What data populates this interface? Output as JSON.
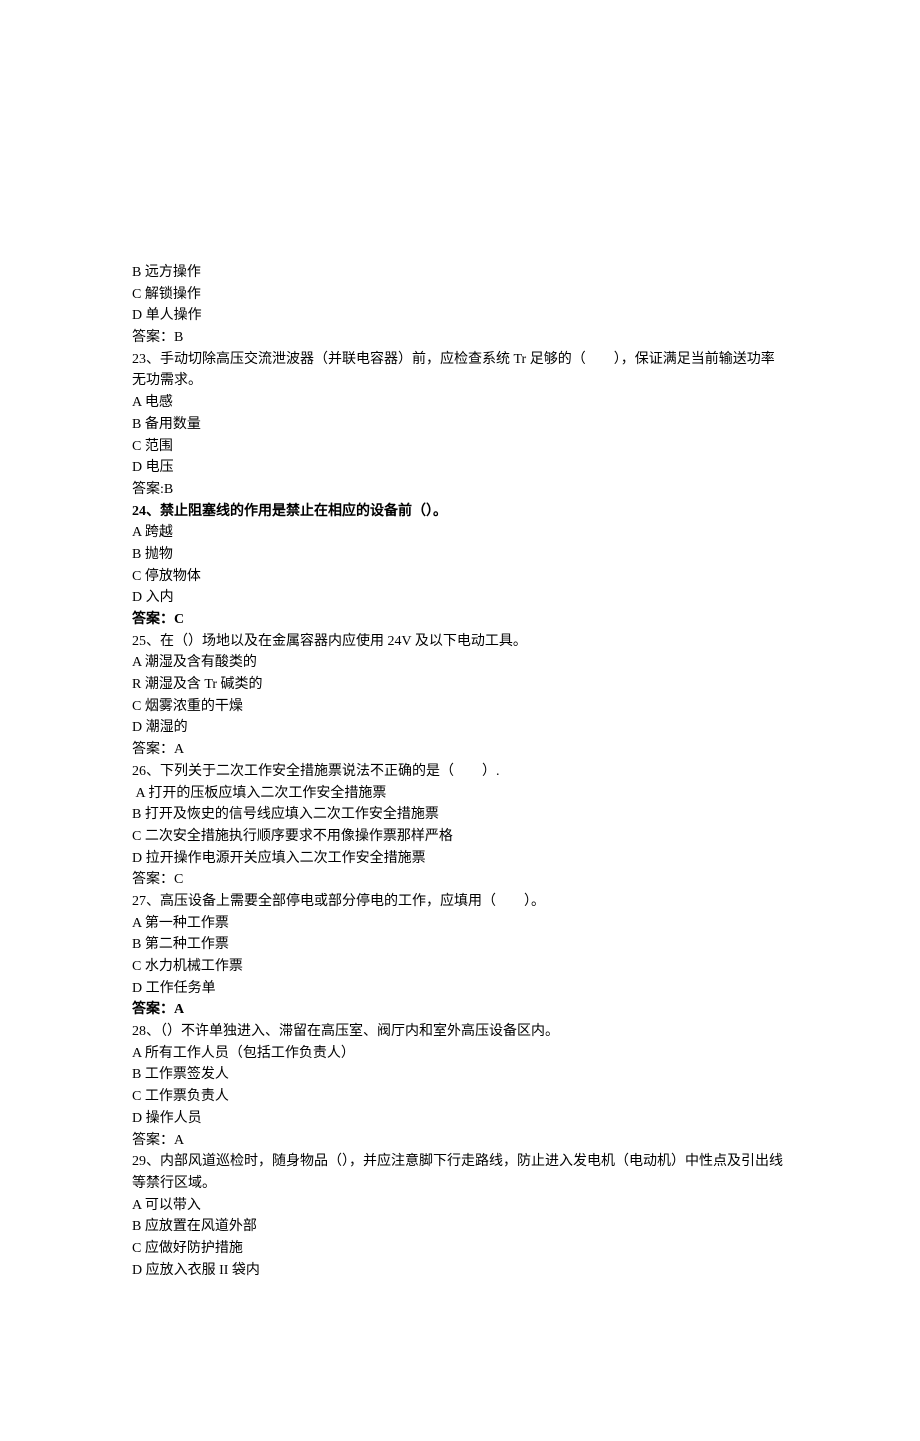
{
  "lines": [
    {
      "text": "B 远方操作",
      "bold": false
    },
    {
      "text": "C 解锁操作",
      "bold": false
    },
    {
      "text": "D 单人操作",
      "bold": false
    },
    {
      "text": "答案：B",
      "bold": false
    },
    {
      "text": "23、手动切除高压交流泄波器（并联电容器）前，应检查系统 Tr 足够的（        ），保证满足当前输送功率无功需求。",
      "bold": false
    },
    {
      "text": "A 电感",
      "bold": false
    },
    {
      "text": "B 备用数量",
      "bold": false
    },
    {
      "text": "C 范围",
      "bold": false
    },
    {
      "text": "D 电压",
      "bold": false
    },
    {
      "text": "答案:B",
      "bold": false
    },
    {
      "text": "24、禁止阻塞线的作用是禁止在相应的设备前（）。",
      "bold": true
    },
    {
      "text": "A 跨越",
      "bold": false
    },
    {
      "text": "B 抛物",
      "bold": false
    },
    {
      "text": "C 停放物体",
      "bold": false
    },
    {
      "text": "D 入内",
      "bold": false
    },
    {
      "text": "答案：C",
      "bold": true
    },
    {
      "text": "25、在（）场地以及在金属容器内应使用 24V 及以下电动工具。",
      "bold": false
    },
    {
      "text": "A 潮湿及含有酸类的",
      "bold": false
    },
    {
      "text": "R 潮湿及含 Tr 碱类的",
      "bold": false
    },
    {
      "text": "C 烟雾浓重的干燥",
      "bold": false
    },
    {
      "text": "D 潮湿的",
      "bold": false
    },
    {
      "text": "答案：A",
      "bold": false
    },
    {
      "text": "26、下列关于二次工作安全措施票说法不正确的是（        ）.",
      "bold": false
    },
    {
      "text": " A 打开的压板应填入二次工作安全措施票",
      "bold": false
    },
    {
      "text": "B 打开及恢史的信号线应填入二次工作安全措施票",
      "bold": false
    },
    {
      "text": "C 二次安全措施执行顺序要求不用像操作票那样严格",
      "bold": false
    },
    {
      "text": "D 拉开操作电源开关应填入二次工作安全措施票",
      "bold": false
    },
    {
      "text": "答案：C",
      "bold": false
    },
    {
      "text": "27、高压设备上需要全部停电或部分停电的工作，应填用（        ）。",
      "bold": false
    },
    {
      "text": "A 第一种工作票",
      "bold": false
    },
    {
      "text": "B 第二种工作票",
      "bold": false
    },
    {
      "text": "C 水力机械工作票",
      "bold": false
    },
    {
      "text": "D 工作任务单",
      "bold": false
    },
    {
      "text": "答案：A",
      "bold": true
    },
    {
      "text": "28、（）不许单独进入、滞留在高压室、阀厅内和室外高压设备区内。",
      "bold": false
    },
    {
      "text": "A 所有工作人员（包括工作负责人）",
      "bold": false
    },
    {
      "text": "B 工作票签发人",
      "bold": false
    },
    {
      "text": "C 工作票负责人",
      "bold": false
    },
    {
      "text": "D 操作人员",
      "bold": false
    },
    {
      "text": "答案：A",
      "bold": false
    },
    {
      "text": "29、内部风道巡检时，随身物品（），并应注意脚下行走路线，防止进入发电机（电动机）中性点及引出线等禁行区域。",
      "bold": false
    },
    {
      "text": "A 可以带入",
      "bold": false
    },
    {
      "text": "B 应放置在风道外部",
      "bold": false
    },
    {
      "text": "C 应做好防护措施",
      "bold": false
    },
    {
      "text": "D 应放入衣服 II 袋内",
      "bold": false
    }
  ]
}
